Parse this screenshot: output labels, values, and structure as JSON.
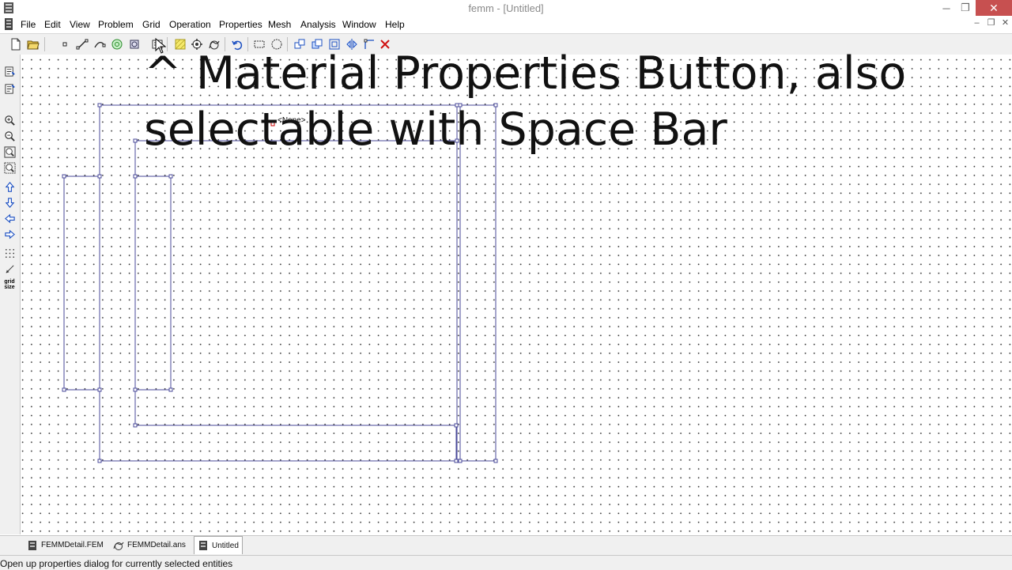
{
  "window": {
    "title": "femm - [Untitled]",
    "minimize_glyph": "─",
    "maximize_glyph": "❐",
    "close_glyph": "✕"
  },
  "menu": {
    "items": [
      "File",
      "Edit",
      "View",
      "Problem",
      "Grid",
      "Operation",
      "Properties",
      "Mesh",
      "Analysis",
      "Window",
      "Help"
    ],
    "mdi_minimize": "–",
    "mdi_restore": "❐",
    "mdi_close": "✕"
  },
  "toolbar": {
    "icons": [
      "new-document-icon",
      "open-folder-icon",
      "node-mode-icon",
      "segment-mode-icon",
      "arc-segment-mode-icon",
      "block-label-mode-icon",
      "group-mode-icon",
      "material-properties-icon",
      "mesh-icon",
      "run-analysis-icon",
      "view-results-icon",
      "undo-icon",
      "select-rectangle-icon",
      "select-circle-icon",
      "move-icon",
      "copy-icon",
      "scale-icon",
      "mirror-icon",
      "fillet-icon",
      "delete-icon"
    ]
  },
  "sidebar": {
    "icons": [
      "zoom-previous-icon",
      "zoom-next-icon",
      "zoom-in-icon",
      "zoom-out-icon",
      "zoom-natural-icon",
      "zoom-window-icon",
      "pan-up-icon",
      "pan-down-icon",
      "pan-left-icon",
      "pan-right-icon",
      "show-grid-icon",
      "snap-grid-icon"
    ],
    "grid_size_label": "grid size"
  },
  "canvas": {
    "annotation_line1": "^ Material Properties Button, also",
    "annotation_line2": "selectable with Space Bar",
    "block_label_text": "<None>"
  },
  "tabs": [
    {
      "label": "FEMMDetail.FEM",
      "icon": "femm-document-icon",
      "active": false
    },
    {
      "label": "FEMMDetail.ans",
      "icon": "femm-solution-icon",
      "active": false
    },
    {
      "label": "Untitled",
      "icon": "femm-document-icon",
      "active": true
    }
  ],
  "status": {
    "text": "Open up properties dialog for currently selected entities"
  },
  "colors": {
    "geometry_line": "#4a4a9a",
    "node_fill": "#ffffff",
    "close_button": "#c75050",
    "block_label_marker": "#cc0000"
  }
}
